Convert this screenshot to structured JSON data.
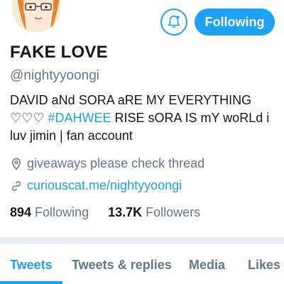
{
  "header": {
    "follow_button_label": "Following",
    "bell_icon": "bell-plus-icon",
    "accent_color": "#1da1f2"
  },
  "profile": {
    "display_name": "FAKE LOVE",
    "handle": "@nightyyoongi",
    "bio_line1": "DAVID aNd SORA aRE MY EVERYTHING",
    "bio_line2_hearts": "♡♡♡",
    "bio_line2_hashtag": "#DAHWEE",
    "bio_line2_rest": "RISE  sORA IS mY woRLd  i",
    "bio_line3": "luv jimin | fan account",
    "location": "giveaways please check thread",
    "location_icon": "location-pin-icon",
    "website": "curiouscat.me/nightyyoongi",
    "website_icon": "link-icon"
  },
  "stats": {
    "following_count": "894",
    "following_label": "Following",
    "followers_count": "13.7K",
    "followers_label": "Followers"
  },
  "tabs": [
    {
      "label": "Tweets",
      "active": true
    },
    {
      "label": "Tweets & replies",
      "active": false
    },
    {
      "label": "Media",
      "active": false
    },
    {
      "label": "Likes",
      "active": false
    }
  ]
}
